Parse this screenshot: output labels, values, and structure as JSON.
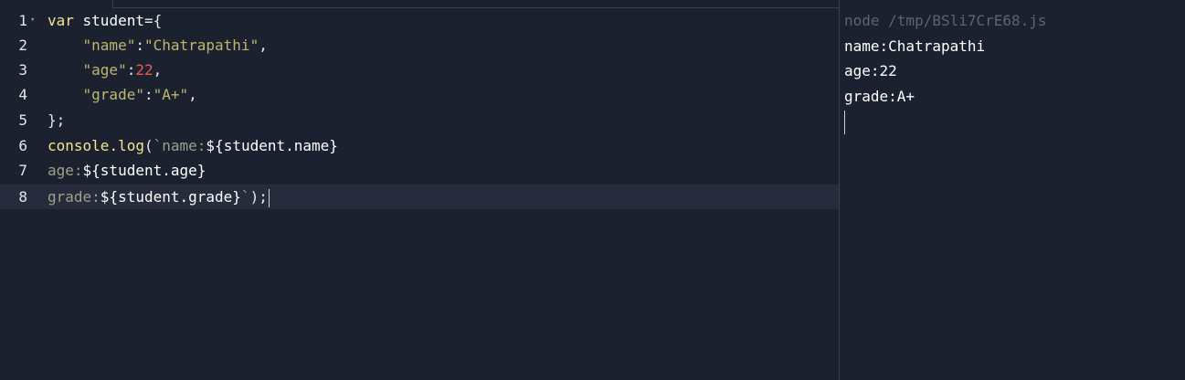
{
  "editor": {
    "line_numbers": [
      "1",
      "2",
      "3",
      "4",
      "5",
      "6",
      "7",
      "8"
    ],
    "fold_marker": "▾",
    "lines": [
      {
        "t1": "var",
        "t2": " student",
        "t3": "={"
      },
      {
        "t1": "    ",
        "t2": "\"name\"",
        "t3": ":",
        "t4": "\"Chatrapathi\"",
        "t5": ","
      },
      {
        "t1": "    ",
        "t2": "\"age\"",
        "t3": ":",
        "t4": "22",
        "t5": ","
      },
      {
        "t1": "    ",
        "t2": "\"grade\"",
        "t3": ":",
        "t4": "\"A+\"",
        "t5": ","
      },
      {
        "t1": "};"
      },
      {
        "t1": "console",
        "t2": ".",
        "t3": "log",
        "t4": "(",
        "t5": "`name:",
        "t6": "${student.name}"
      },
      {
        "t1": "age:",
        "t2": "${student.age}"
      },
      {
        "t1": "grade:",
        "t2": "${student.grade}",
        "t3": "`",
        "t4": ");"
      }
    ]
  },
  "output": {
    "command": "node /tmp/BSli7CrE68.js",
    "lines": [
      "name:Chatrapathi",
      "age:22",
      "grade:A+"
    ]
  }
}
